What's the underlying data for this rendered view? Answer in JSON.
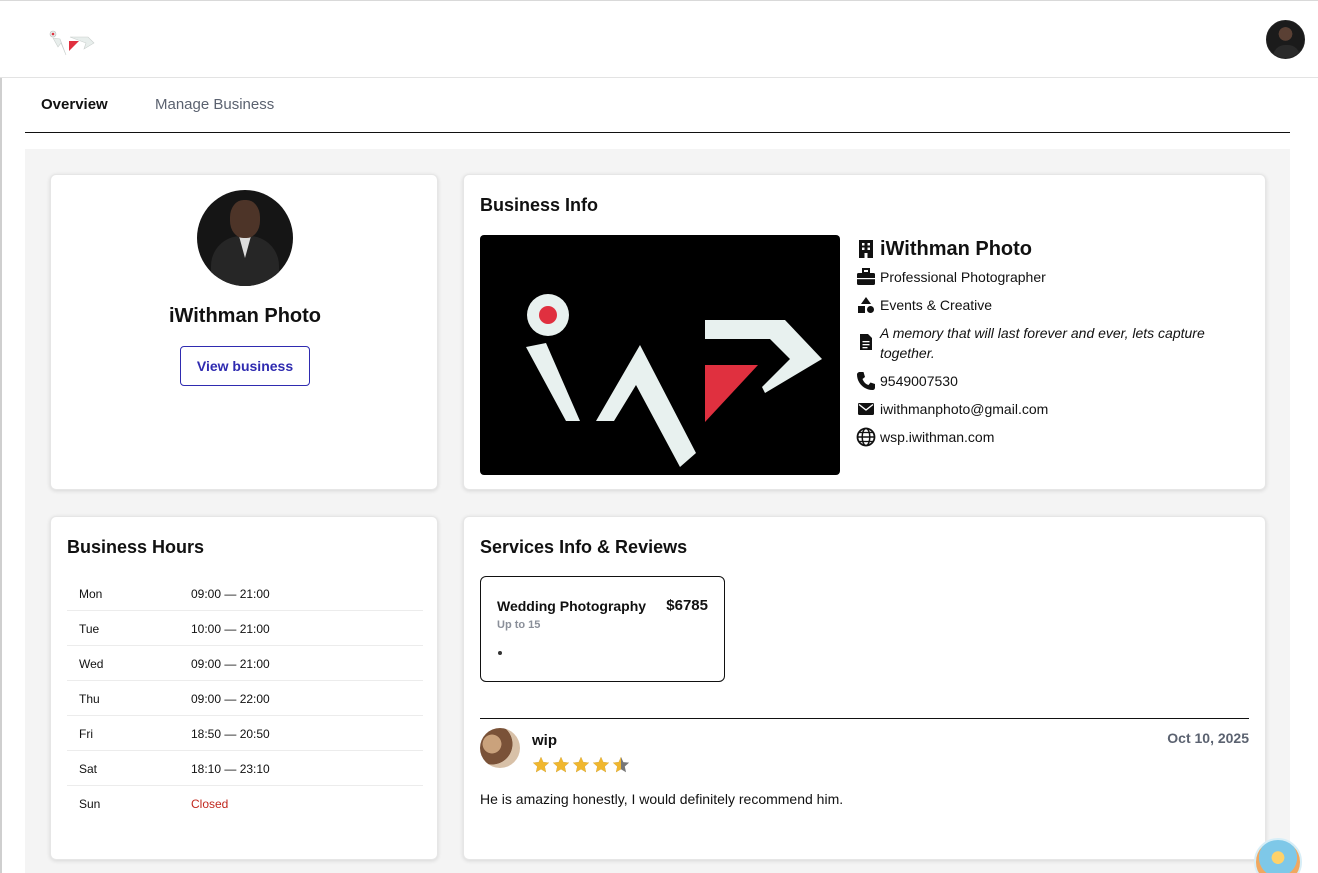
{
  "header": {
    "logo_icon": "iwp-logo-icon",
    "avatar_icon": "user-avatar-icon"
  },
  "tabs": [
    {
      "label": "Overview",
      "active": true
    },
    {
      "label": "Manage Business",
      "active": false
    }
  ],
  "profile": {
    "name": "iWithman Photo",
    "view_button": "View business"
  },
  "business_info": {
    "heading": "Business Info",
    "name": "iWithman Photo",
    "category": "Professional Photographer",
    "subcategory": "Events & Creative",
    "description": "A memory that will last forever and ever, lets capture together.",
    "phone": "9549007530",
    "email": "iwithmanphoto@gmail.com",
    "website": "wsp.iwithman.com"
  },
  "business_hours": {
    "heading": "Business Hours",
    "rows": [
      {
        "day": "Mon",
        "time": "09:00 — 21:00"
      },
      {
        "day": "Tue",
        "time": "10:00 — 21:00"
      },
      {
        "day": "Wed",
        "time": "09:00 — 21:00"
      },
      {
        "day": "Thu",
        "time": "09:00 — 22:00"
      },
      {
        "day": "Fri",
        "time": "18:50 — 20:50"
      },
      {
        "day": "Sat",
        "time": "18:10 — 23:10"
      },
      {
        "day": "Sun",
        "time": "Closed"
      }
    ]
  },
  "services": {
    "heading": "Services Info & Reviews",
    "items": [
      {
        "name": "Wedding Photography",
        "price": "$6785",
        "subtitle": "Up to 15"
      }
    ]
  },
  "review": {
    "author": "wip",
    "date": "Oct 10, 2025",
    "rating": 4.5,
    "text": "He is amazing honestly, I would definitely recommend him."
  },
  "colors": {
    "accent": "#2f2bb0",
    "closed": "#c0281e",
    "star": "#f0b72f",
    "logo_red": "#e0303f"
  }
}
